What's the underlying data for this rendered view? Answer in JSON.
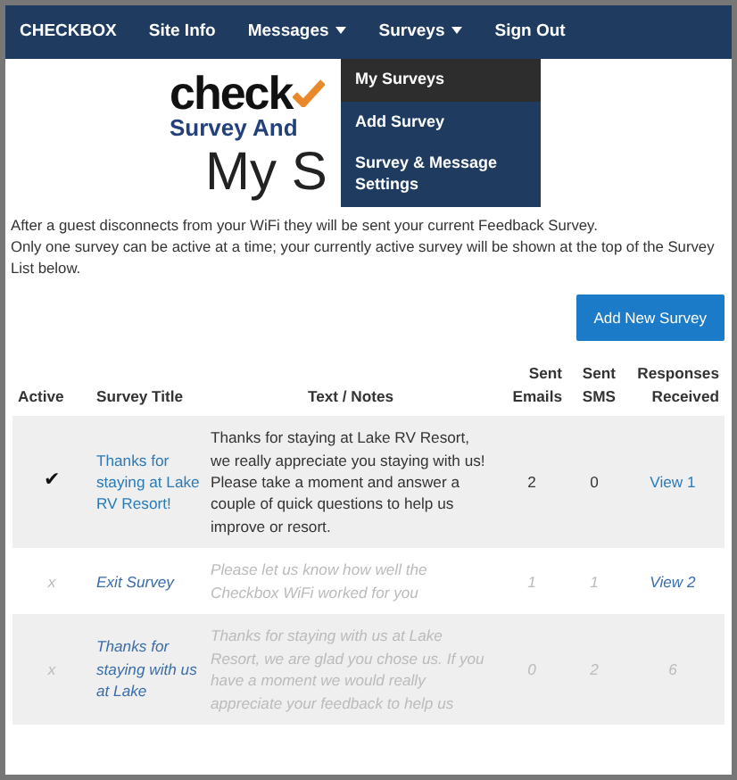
{
  "navbar": {
    "brand": "CHECKBOX",
    "items": [
      {
        "label": "Site Info",
        "dropdown": false
      },
      {
        "label": "Messages",
        "dropdown": true
      },
      {
        "label": "Surveys",
        "dropdown": true
      },
      {
        "label": "Sign Out",
        "dropdown": false
      }
    ]
  },
  "dropdown_menu": [
    {
      "label": "My Surveys",
      "selected": true
    },
    {
      "label": "Add Survey",
      "selected": false
    },
    {
      "label": "Survey & Message Settings",
      "selected": false
    }
  ],
  "logo": {
    "wordmark": "check",
    "tagline": "Survey And"
  },
  "page_title": "My S",
  "intro": [
    "After a guest disconnects from your WiFi they will be sent your current Feedback Survey.",
    "Only one survey can be active at a time; your currently active survey will be shown at the top of the Survey List below."
  ],
  "add_button": "Add New Survey",
  "table": {
    "columns": [
      "Active",
      "Survey Title",
      "Text / Notes",
      "Sent Emails",
      "Sent SMS",
      "Responses Received"
    ],
    "rows": [
      {
        "active": true,
        "mark": "✔",
        "title": "Thanks for staying at Lake RV Resort!",
        "text": "Thanks for staying at Lake RV Resort, we really appreciate you staying with us! Please take a moment and answer a couple of quick questions to help us improve or resort.",
        "emails": "2",
        "sms": "0",
        "responses": "View 1"
      },
      {
        "active": false,
        "mark": "x",
        "title": "Exit Survey",
        "text": "Please let us know how well the Checkbox WiFi worked for you",
        "emails": "1",
        "sms": "1",
        "responses": "View 2"
      },
      {
        "active": false,
        "mark": "x",
        "title": "Thanks for staying with us at Lake",
        "text": "Thanks for staying with us at Lake Resort, we are glad you chose us. If you have a moment we would really appreciate your feedback to help us",
        "emails": "0",
        "sms": "2",
        "responses": "6"
      }
    ]
  }
}
